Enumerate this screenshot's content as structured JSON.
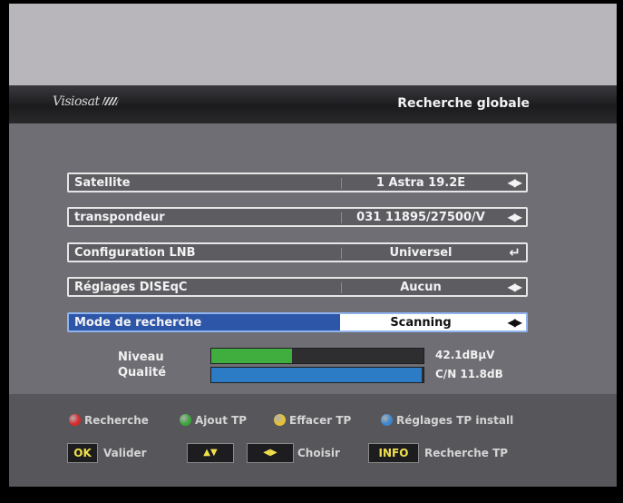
{
  "header": {
    "logo_text": "Visiosat",
    "title": "Recherche globale"
  },
  "rows": [
    {
      "label": "Satellite",
      "value": "1 Astra 19.2E",
      "control": "left-right-arrows-icon"
    },
    {
      "label": "transpondeur",
      "value": "031 11895/27500/V",
      "control": "left-right-arrows-icon"
    },
    {
      "label": "Configuration LNB",
      "value": "Universel",
      "control": "enter-icon"
    },
    {
      "label": "Réglages DISEqC",
      "value": "Aucun",
      "control": "left-right-arrows-icon"
    },
    {
      "label": "Mode de recherche",
      "value": "Scanning",
      "control": "left-right-arrows-icon",
      "selected": true
    }
  ],
  "signal": {
    "level_label": "Niveau",
    "level_value": "42.1dBµV",
    "level_fraction": 0.38,
    "quality_label": "Qualité",
    "quality_value": "C/N 11.8dB",
    "quality_fraction": 0.99,
    "level_color": "#3fae3f",
    "quality_color": "#2b7cc4"
  },
  "legend": [
    {
      "color": "#d92a2a",
      "label": "Recherche"
    },
    {
      "color": "#39a839",
      "label": "Ajout TP"
    },
    {
      "color": "#e8c233",
      "label": "Effacer TP"
    },
    {
      "color": "#3a86d0",
      "label": "Réglages TP install"
    }
  ],
  "keys": {
    "ok": "OK",
    "ok_label": "Valider",
    "updown": "▲▼",
    "leftright": "◀▶",
    "leftright_label": "Choisir",
    "info": "INFO",
    "info_label": "Recherche TP"
  }
}
